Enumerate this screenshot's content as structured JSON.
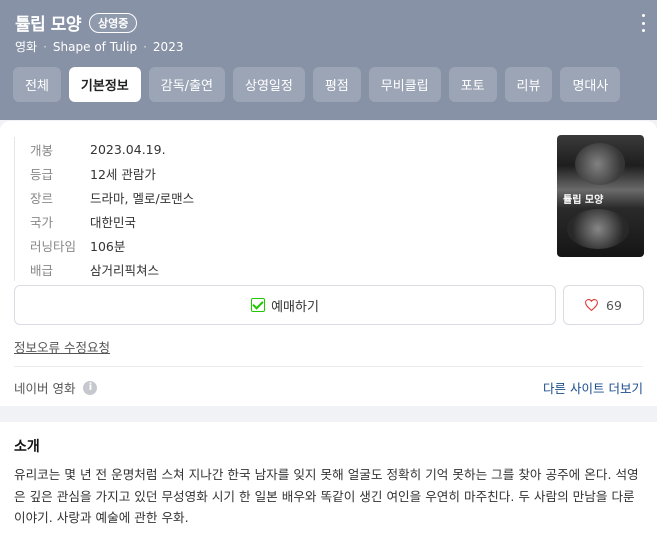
{
  "header": {
    "title": "튤립 모양",
    "status_badge": "상영중",
    "category": "영화",
    "original_title": "Shape of Tulip",
    "year": "2023",
    "separator": "·",
    "tabs": [
      {
        "label": "전체",
        "active": false
      },
      {
        "label": "기본정보",
        "active": true
      },
      {
        "label": "감독/출연",
        "active": false
      },
      {
        "label": "상영일정",
        "active": false
      },
      {
        "label": "평점",
        "active": false
      },
      {
        "label": "무비클립",
        "active": false
      },
      {
        "label": "포토",
        "active": false
      },
      {
        "label": "리뷰",
        "active": false
      },
      {
        "label": "명대사",
        "active": false
      }
    ]
  },
  "info": {
    "rows": [
      {
        "key": "개봉",
        "value": "2023.04.19."
      },
      {
        "key": "등급",
        "value": "12세 관람가"
      },
      {
        "key": "장르",
        "value": "드라마, 멜로/로맨스"
      },
      {
        "key": "국가",
        "value": "대한민국"
      },
      {
        "key": "러닝타임",
        "value": "106분"
      },
      {
        "key": "배급",
        "value": "삼거리픽쳐스"
      }
    ],
    "poster_title": "튤립 모양"
  },
  "actions": {
    "reserve_label": "예매하기",
    "like_count": "69",
    "report_link": "정보오류 수정요청"
  },
  "source": {
    "label": "네이버 영화",
    "info_icon": "i",
    "other_sites": "다른 사이트 더보기"
  },
  "intro": {
    "heading": "소개",
    "text": "유리코는 몇 년 전 운명처럼 스쳐 지나간 한국 남자를 잊지 못해 얼굴도 정확히 기억 못하는 그를 찾아 공주에 온다. 석영은 깊은 관심을 가지고 있던 무성영화 시기 한 일본 배우와 똑같이 생긴 여인을 우연히 마주친다. 두 사람의 만남을 다룬 이야기. 사랑과 예술에 관한 우화."
  },
  "colors": {
    "header_bg": "#8792a6",
    "link": "#1b4c8c",
    "check": "#1ec800",
    "heart": "#e03a3a"
  }
}
